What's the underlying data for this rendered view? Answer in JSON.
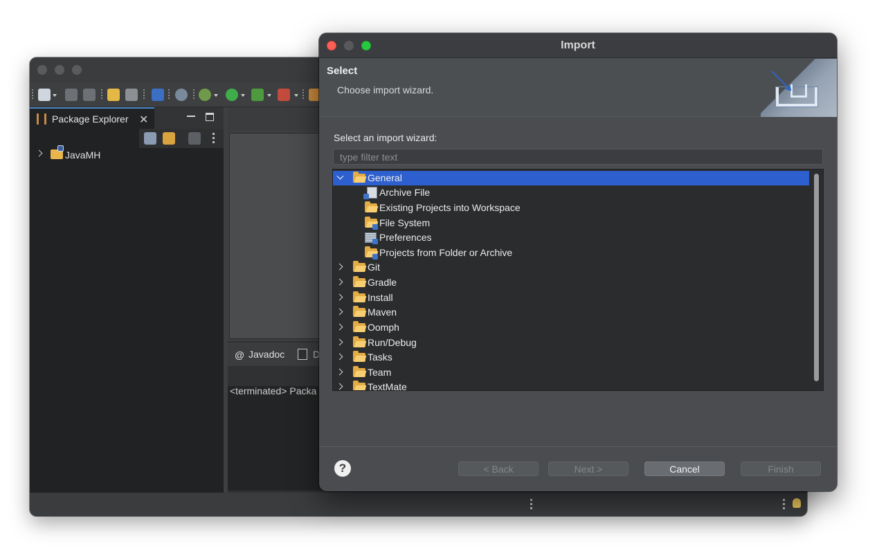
{
  "eclipse": {
    "package_explorer": {
      "tab_label": "Package Explorer",
      "project_label": "JavaMH"
    },
    "bottom_panel": {
      "javadoc_label": "Javadoc",
      "declaration_label": "D",
      "console_text": "<terminated> Packa"
    }
  },
  "dialog": {
    "title": "Import",
    "header_title": "Select",
    "header_description": "Choose import wizard.",
    "wizard_label": "Select an import wizard:",
    "filter_placeholder": "type filter text",
    "tree": [
      {
        "label": "General",
        "expanded": true,
        "selected": true
      },
      {
        "label": "Archive File",
        "child": true,
        "icon": "archive-file-icon"
      },
      {
        "label": "Existing Projects into Workspace",
        "child": true,
        "icon": "existing-projects-icon"
      },
      {
        "label": "File System",
        "child": true,
        "icon": "file-system-icon"
      },
      {
        "label": "Preferences",
        "child": true,
        "icon": "preferences-icon"
      },
      {
        "label": "Projects from Folder or Archive",
        "child": true,
        "icon": "projects-folder-icon"
      },
      {
        "label": "Git"
      },
      {
        "label": "Gradle"
      },
      {
        "label": "Install"
      },
      {
        "label": "Maven"
      },
      {
        "label": "Oomph"
      },
      {
        "label": "Run/Debug"
      },
      {
        "label": "Tasks"
      },
      {
        "label": "Team"
      },
      {
        "label": "TextMate"
      }
    ],
    "buttons": {
      "help": "?",
      "back": "< Back",
      "next": "Next >",
      "cancel": "Cancel",
      "finish": "Finish"
    }
  },
  "colors": {
    "selection": "#2d5fce",
    "folder": "#e3ac44",
    "close_button": "#ff5f57",
    "zoom_button": "#28c840"
  }
}
